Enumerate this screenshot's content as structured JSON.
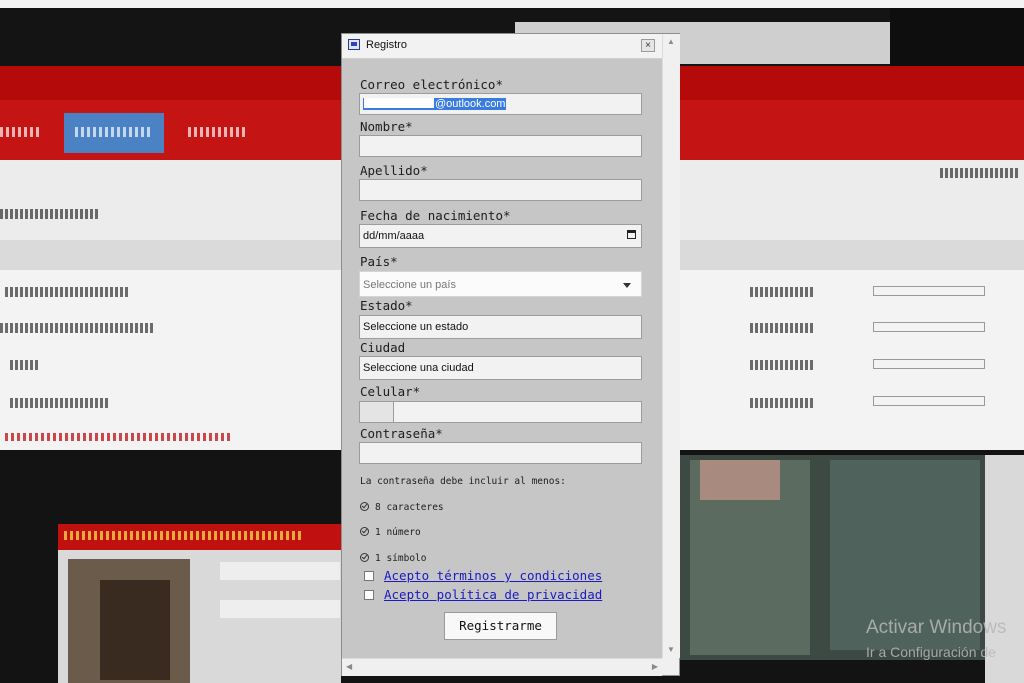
{
  "dialog": {
    "title": "Registro",
    "close_glyph": "×"
  },
  "form": {
    "email": {
      "label": "Correo electrónico*",
      "value_hidden_part": "",
      "value_suffix": "@outlook.com"
    },
    "nombre": {
      "label": "Nombre*",
      "value": ""
    },
    "apellido": {
      "label": "Apellido*",
      "value": ""
    },
    "fecha": {
      "label": "Fecha de nacimiento*",
      "value": "dd/mm/aaaa"
    },
    "pais": {
      "label": "País*",
      "placeholder": "Seleccione un país"
    },
    "estado": {
      "label": "Estado*",
      "value": "Seleccione un estado"
    },
    "ciudad": {
      "label": "Ciudad",
      "value": "Seleccione una ciudad"
    },
    "celular": {
      "label": "Celular*",
      "value": ""
    },
    "contrasena": {
      "label": "Contraseña*",
      "value": ""
    },
    "password_hint": "La contraseña debe incluir al menos:",
    "password_rules": [
      "8 caracteres",
      "1 número",
      "1 símbolo"
    ],
    "terms_label": "Acepto términos y condiciones",
    "privacy_label": "Acepto política de privacidad",
    "submit_label": "Registrarme"
  },
  "icons": {
    "window": "window-icon",
    "calendar": "calendar-icon",
    "check": "check-circle-icon"
  },
  "watermark": {
    "line1": "Activar Windows",
    "line2": "Ir a Configuración de"
  },
  "colors": {
    "selection": "#3a7be0",
    "link": "#1a1ac0",
    "background_bar": "#b40a0a"
  }
}
